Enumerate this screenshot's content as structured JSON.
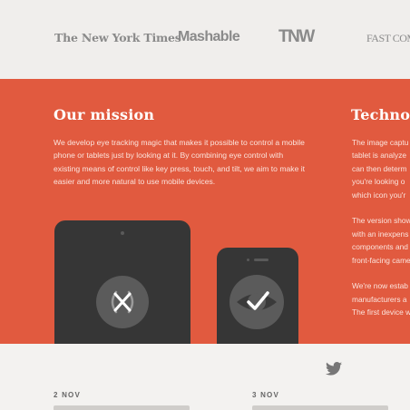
{
  "press": {
    "logos": [
      {
        "name": "nyt",
        "text": "The New York Times"
      },
      {
        "name": "mashable",
        "text": "Mashable"
      },
      {
        "name": "tnw",
        "text": "TNW"
      },
      {
        "name": "fastcompany",
        "text": "FAST COMPA"
      }
    ]
  },
  "mission": {
    "title": "Our mission",
    "body": "We develop eye tracking magic that makes it possible to control a mobile phone or tablets just by looking at it. By combining eye control with existing means of control like key press, touch, and tilt, we aim to make it easier and more natural to use mobile devices."
  },
  "technology": {
    "title": "Technol",
    "lines": [
      "The image captu",
      "tablet is analyze",
      "can then determ",
      "you're looking o",
      "which icon you'r"
    ],
    "lines2": [
      "The version show",
      "with an inexpens",
      "components and",
      "front-facing came"
    ],
    "lines3": [
      "We're now estab",
      "manufacturers a",
      "The first device w"
    ]
  },
  "devices": {
    "tablet_icon": "x-mark-eye-icon",
    "phone_icon": "checkmark-eye-icon"
  },
  "news": {
    "items": [
      {
        "date": "2 NOV"
      },
      {
        "date": "3 NOV"
      }
    ]
  },
  "colors": {
    "band": "#e15a3f",
    "device": "#363636",
    "background": "#f0eeec"
  }
}
